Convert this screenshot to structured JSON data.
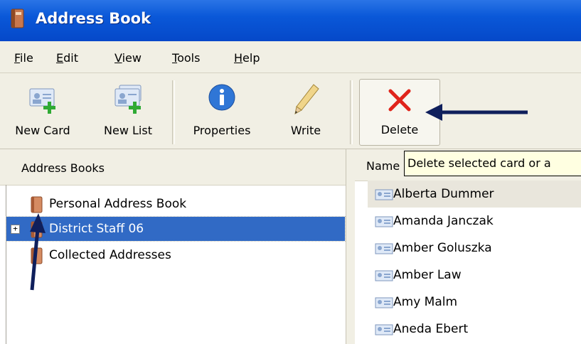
{
  "window": {
    "title": "Address Book"
  },
  "menu": [
    {
      "label": "File",
      "accel": "F",
      "rest": "ile"
    },
    {
      "label": "Edit",
      "accel": "E",
      "rest": "dit"
    },
    {
      "label": "View",
      "accel": "V",
      "rest": "iew"
    },
    {
      "label": "Tools",
      "accel": "T",
      "rest": "ools"
    },
    {
      "label": "Help",
      "accel": "H",
      "rest": "elp"
    }
  ],
  "toolbar": {
    "new_card": "New Card",
    "new_list": "New List",
    "properties": "Properties",
    "write": "Write",
    "delete": "Delete"
  },
  "tooltip": "Delete selected card or a",
  "left_pane": {
    "header": "Address Books",
    "items": [
      {
        "label": "Personal Address Book"
      },
      {
        "label": "District Staff 06",
        "selected": true,
        "expander": "+"
      },
      {
        "label": "Collected Addresses"
      }
    ]
  },
  "right_pane": {
    "column": "Name",
    "rows": [
      {
        "name": "Alberta Dummer",
        "selected": true
      },
      {
        "name": "Amanda Janczak"
      },
      {
        "name": "Amber Goluszka"
      },
      {
        "name": "Amber Law"
      },
      {
        "name": "Amy Malm"
      },
      {
        "name": "Aneda Ebert"
      }
    ]
  },
  "colors": {
    "accent": "#0548c9",
    "selection": "#316ac5",
    "delete_x": "#e0241b",
    "arrow": "#0f1f5c"
  }
}
